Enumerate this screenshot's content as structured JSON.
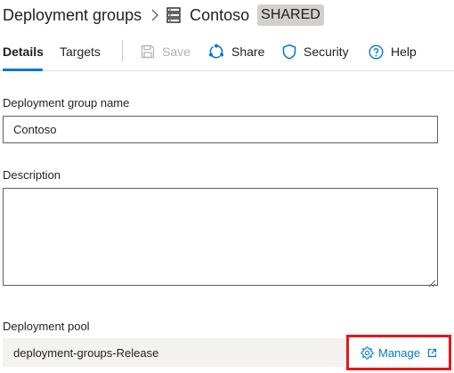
{
  "breadcrumb": {
    "root": "Deployment groups",
    "current": "Contoso",
    "badge": "SHARED"
  },
  "tabs": [
    {
      "label": "Details",
      "active": true
    },
    {
      "label": "Targets",
      "active": false
    }
  ],
  "commands": {
    "save": {
      "label": "Save",
      "disabled": true,
      "icon": "save-icon"
    },
    "share": {
      "label": "Share",
      "icon": "share-icon"
    },
    "security": {
      "label": "Security",
      "icon": "shield-icon"
    },
    "help": {
      "label": "Help",
      "icon": "help-icon"
    }
  },
  "form": {
    "name_label": "Deployment group name",
    "name_value": "Contoso",
    "description_label": "Description",
    "description_value": "",
    "pool_label": "Deployment pool",
    "pool_value": "deployment-groups-Release",
    "manage_label": "Manage"
  },
  "colors": {
    "accent": "#0078d4",
    "highlight_border": "#e8161b",
    "badge_bg": "#d2d0ce"
  }
}
